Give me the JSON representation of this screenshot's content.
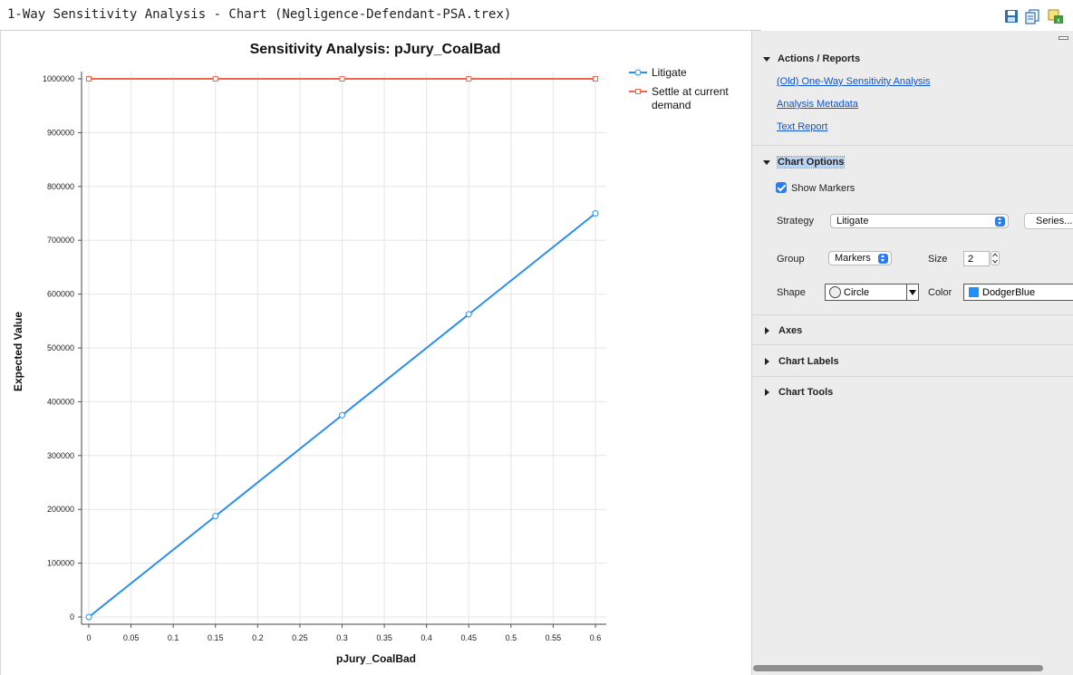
{
  "window": {
    "title": "1-Way Sensitivity Analysis - Chart (Negligence-Defendant-PSA.trex)",
    "toolbar_icons": [
      "save-icon",
      "copy-icon",
      "export-icon"
    ]
  },
  "panel": {
    "actions": {
      "header": "Actions / Reports",
      "links": [
        "(Old) One-Way Sensitivity Analysis",
        "Analysis Metadata",
        "Text Report"
      ]
    },
    "chart_options": {
      "header": "Chart Options",
      "show_markers_label": "Show Markers",
      "show_markers_checked": true,
      "strategy_label": "Strategy",
      "strategy_value": "Litigate",
      "series_button": "Series...",
      "group_label": "Group",
      "group_value": "Markers",
      "size_label": "Size",
      "size_value": "2",
      "shape_label": "Shape",
      "shape_value": "Circle",
      "color_label": "Color",
      "color_value": "DodgerBlue",
      "color_swatch": "#1e90ff"
    },
    "collapsed_sections": [
      "Axes",
      "Chart Labels",
      "Chart Tools"
    ]
  },
  "chart_data": {
    "type": "line",
    "title": "Sensitivity Analysis: pJury_CoalBad",
    "xlabel": "pJury_CoalBad",
    "ylabel": "Expected Value",
    "xlim": [
      0,
      0.6
    ],
    "ylim": [
      0,
      1000000
    ],
    "x_ticks": [
      "0",
      "0.05",
      "0.1",
      "0.15",
      "0.2",
      "0.25",
      "0.3",
      "0.35",
      "0.4",
      "0.45",
      "0.5",
      "0.55",
      "0.6"
    ],
    "y_ticks": [
      "0",
      "100000",
      "200000",
      "300000",
      "400000",
      "500000",
      "600000",
      "700000",
      "800000",
      "900000",
      "1000000"
    ],
    "grid": true,
    "legend_position": "top-right",
    "series": [
      {
        "name": "Litigate",
        "color": "#2a8ff0",
        "marker": "circle",
        "x": [
          0,
          0.15,
          0.3,
          0.45,
          0.6
        ],
        "y": [
          0,
          187500,
          375000,
          562500,
          750000
        ]
      },
      {
        "name": "Settle at current demand",
        "color": "#f2654f",
        "marker": "square",
        "x": [
          0,
          0.15,
          0.3,
          0.45,
          0.6
        ],
        "y": [
          1000000,
          1000000,
          1000000,
          1000000,
          1000000
        ]
      }
    ]
  }
}
